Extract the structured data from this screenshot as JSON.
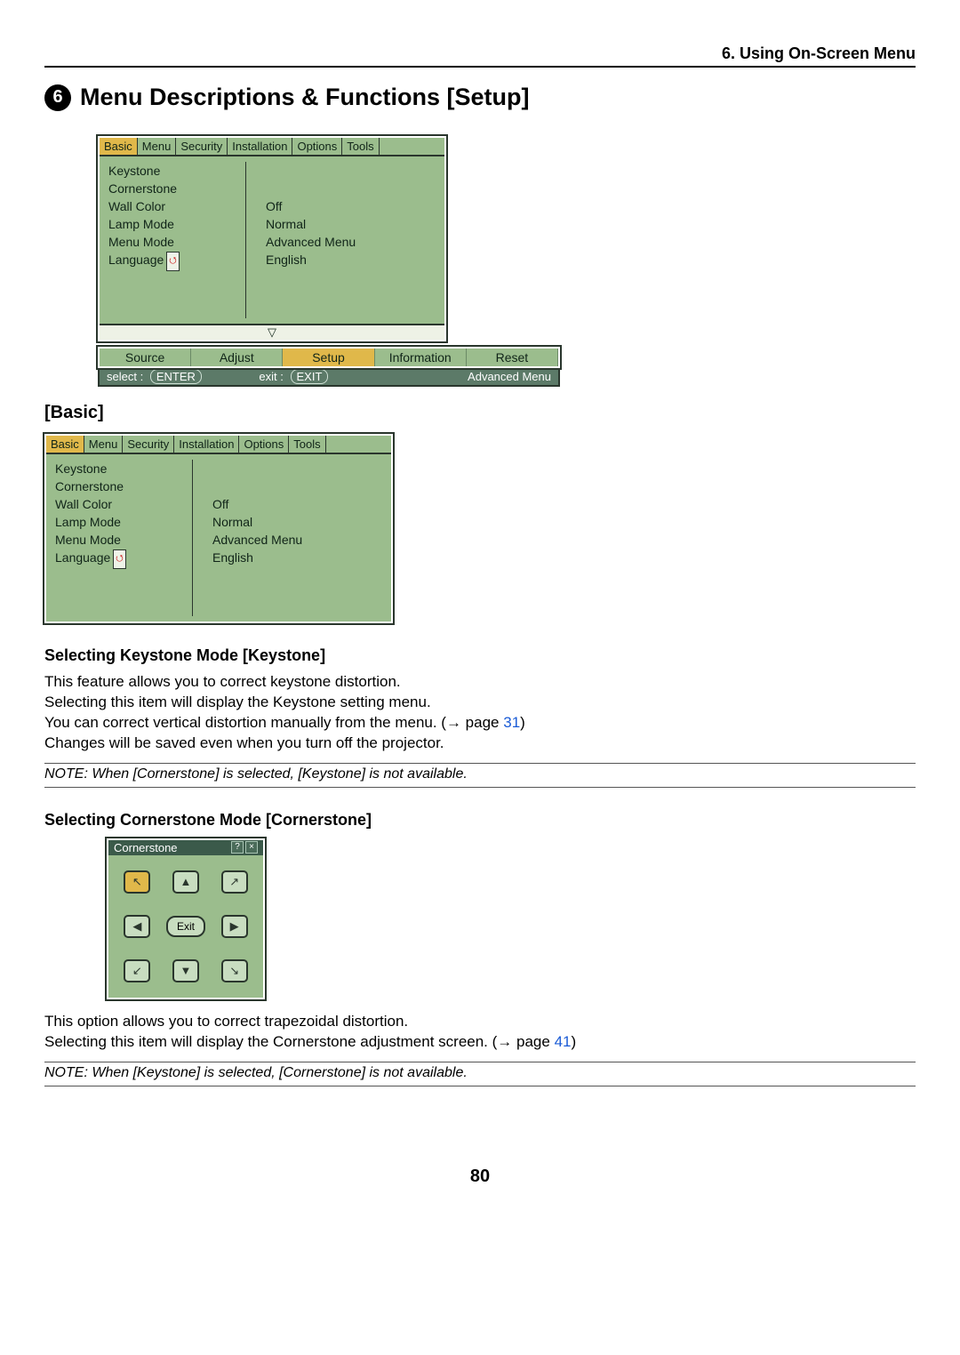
{
  "header": "6. Using On-Screen Menu",
  "section_number": "6",
  "section_title": "Menu Descriptions & Functions [Setup]",
  "osd1": {
    "tabs": [
      "Basic",
      "Menu",
      "Security",
      "Installation",
      "Options",
      "Tools"
    ],
    "active_tab": "Basic",
    "items": [
      {
        "label": "Keystone",
        "value": ""
      },
      {
        "label": "Cornerstone",
        "value": ""
      },
      {
        "label": "Wall Color",
        "value": "Off"
      },
      {
        "label": "Lamp Mode",
        "value": "Normal"
      },
      {
        "label": "Menu Mode",
        "value": "Advanced Menu"
      },
      {
        "label": "Language",
        "value": "English",
        "lang_icon": true
      }
    ],
    "bottom_row": [
      "Source",
      "Adjust",
      "Setup",
      "Information",
      "Reset"
    ],
    "bottom_active": "Setup",
    "status": {
      "select_label": "select :",
      "select_key": "ENTER",
      "exit_label": "exit :",
      "exit_key": "EXIT",
      "right": "Advanced Menu"
    }
  },
  "basic_heading": "[Basic]",
  "osd2": {
    "tabs": [
      "Basic",
      "Menu",
      "Security",
      "Installation",
      "Options",
      "Tools"
    ],
    "active_tab": "Basic",
    "items": [
      {
        "label": "Keystone",
        "value": ""
      },
      {
        "label": "Cornerstone",
        "value": ""
      },
      {
        "label": "Wall Color",
        "value": "Off"
      },
      {
        "label": "Lamp Mode",
        "value": "Normal"
      },
      {
        "label": "Menu Mode",
        "value": "Advanced Menu"
      },
      {
        "label": "Language",
        "value": "English",
        "lang_icon": true
      }
    ]
  },
  "keystone": {
    "heading": "Selecting Keystone Mode [Keystone]",
    "p1": "This feature allows you to correct keystone distortion.",
    "p2": "Selecting this item will display the Keystone setting menu.",
    "p3a": "You can correct vertical distortion manually from the menu. (→ page ",
    "p3link": "31",
    "p3b": ")",
    "p4": "Changes will be saved even when you turn off the projector.",
    "note": "NOTE: When [Cornerstone] is selected, [Keystone] is not available."
  },
  "cornerstone": {
    "heading": "Selecting Cornerstone Mode [Cornerstone]",
    "dialog_title": "Cornerstone",
    "exit_label": "Exit",
    "arrows": [
      "↖",
      "▲",
      "↗",
      "◀",
      "",
      "▶",
      "↙",
      "▼",
      "↘"
    ],
    "p1": "This option allows you to correct trapezoidal distortion.",
    "p2a": "Selecting this item will display the Cornerstone adjustment screen. (→ page ",
    "p2link": "41",
    "p2b": ")",
    "note": "NOTE: When [Keystone] is selected, [Cornerstone] is not available."
  },
  "page_number": "80"
}
